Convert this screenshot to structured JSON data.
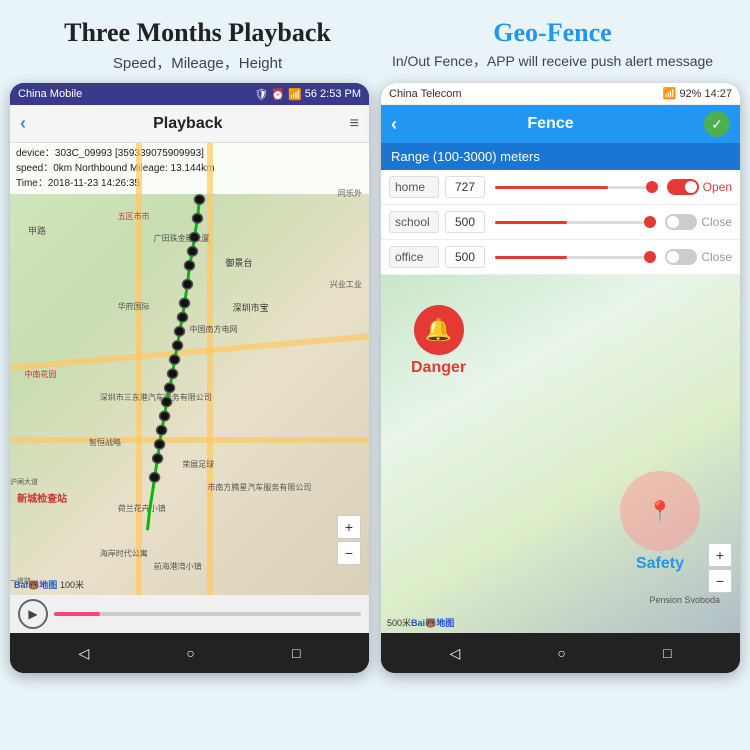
{
  "header": {
    "left_title": "Three Months Playback",
    "left_subtitle": "Speed，Mileage，Height",
    "right_title": "Geo-Fence",
    "right_subtitle": "In/Out Fence，APP will receive push alert message"
  },
  "playback_phone": {
    "status_bar": {
      "carrier": "China Mobile",
      "time": "2:53 PM",
      "signal": "4G",
      "battery": "56"
    },
    "nav": {
      "back": "‹",
      "title": "Playback",
      "menu": "≡"
    },
    "info_box": {
      "line1": "device：303C_09993 [359339075909993]",
      "line2": "speed：0km Northbound Mileage: 13.144km",
      "line3": "Time：2018-11-23 14:26:35"
    },
    "bottom_nav": {
      "back": "◁",
      "home": "○",
      "recent": "□"
    },
    "baidu_label": "Bai🐻地图",
    "scale_label": "100米"
  },
  "fence_phone": {
    "status_bar": {
      "carrier": "China Telecom",
      "time": "14:27",
      "battery": "92%",
      "signal": "4G"
    },
    "nav": {
      "back": "‹",
      "title": "Fence",
      "check": "✓"
    },
    "range_label": "Range (100-3000) meters",
    "fence_items": [
      {
        "name": "home",
        "value": "727",
        "fill_pct": 70,
        "fill_color": "#e53935",
        "toggle": "Open",
        "toggle_type": "open"
      },
      {
        "name": "school",
        "value": "500",
        "fill_pct": 45,
        "fill_color": "#e53935",
        "toggle": "Close",
        "toggle_type": "close"
      },
      {
        "name": "office",
        "value": "500",
        "fill_pct": 45,
        "fill_color": "#e53935",
        "toggle": "Close",
        "toggle_type": "close"
      }
    ],
    "danger_label": "Danger",
    "safety_label": "Safety",
    "zoom_plus": "+",
    "zoom_minus": "−",
    "pension_label": "Pension Svoboda",
    "scale_label": "500米",
    "baidu_label": "Bai🐻地图",
    "bottom_nav": {
      "back": "◁",
      "home": "○",
      "recent": "□"
    }
  }
}
